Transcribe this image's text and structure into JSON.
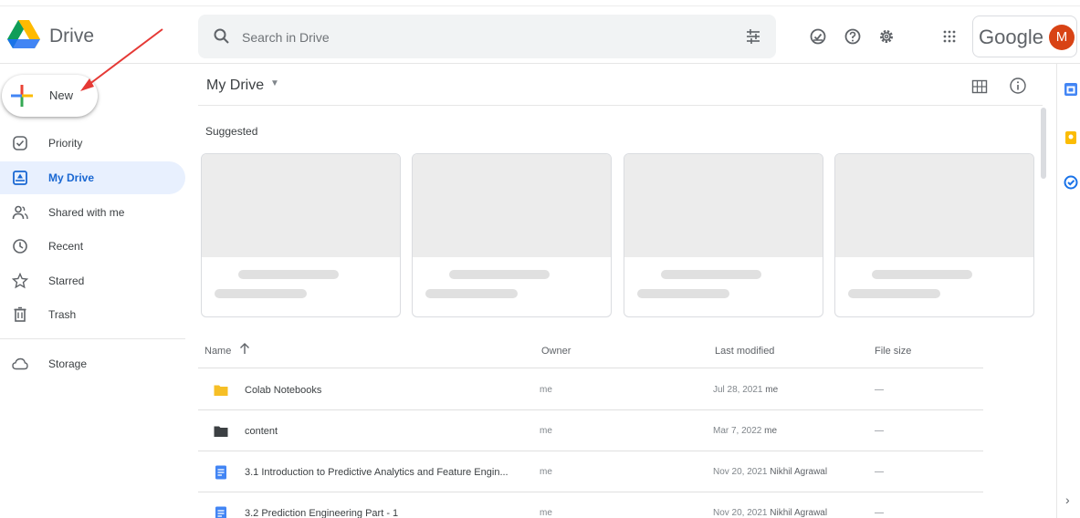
{
  "app": {
    "name": "Drive"
  },
  "search": {
    "placeholder": "Search in Drive"
  },
  "account": {
    "brand": "Google",
    "avatar_letter": "M"
  },
  "sidebar": {
    "new_label": "New",
    "items": [
      {
        "label": "Priority",
        "icon": "priority-icon"
      },
      {
        "label": "My Drive",
        "icon": "my-drive-icon",
        "active": true
      },
      {
        "label": "Shared with me",
        "icon": "shared-icon"
      },
      {
        "label": "Recent",
        "icon": "clock-icon"
      },
      {
        "label": "Starred",
        "icon": "star-icon"
      },
      {
        "label": "Trash",
        "icon": "trash-icon"
      },
      {
        "label": "Storage",
        "icon": "cloud-icon"
      }
    ]
  },
  "main": {
    "title": "My Drive",
    "section_label": "Suggested",
    "table": {
      "headers": {
        "name": "Name",
        "owner": "Owner",
        "last_modified": "Last modified",
        "file_size": "File size"
      },
      "rows": [
        {
          "name": "Colab Notebooks",
          "type": "folder",
          "owner": "me",
          "modified": "Jul 28, 2021",
          "modified_by": "me",
          "size": "—"
        },
        {
          "name": "content",
          "type": "folder-dark",
          "owner": "me",
          "modified": "Mar 7, 2022",
          "modified_by": "me",
          "size": "—"
        },
        {
          "name": "3.1 Introduction to Predictive Analytics and Feature Engin...",
          "type": "doc",
          "owner": "me",
          "modified": "Nov 20, 2021",
          "modified_by": "Nikhil Agrawal",
          "size": "—"
        },
        {
          "name": "3.2 Prediction Engineering Part - 1",
          "type": "doc",
          "owner": "me",
          "modified": "Nov 20, 2021",
          "modified_by": "Nikhil Agrawal",
          "size": "—"
        }
      ]
    }
  },
  "colors": {
    "accent": "#1967d2",
    "active_bg": "#e8f0fe",
    "folder_yellow": "#f6bf26",
    "folder_dark": "#3c4043",
    "doc_blue": "#4285f4",
    "avatar": "#d84315"
  }
}
